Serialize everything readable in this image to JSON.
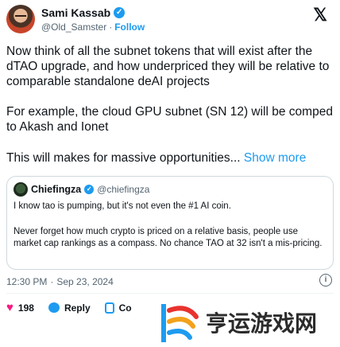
{
  "author": {
    "name": "Sami Kassab",
    "handle": "@Old_Samster",
    "separator": "·",
    "follow_label": "Follow"
  },
  "platform_icon": "x-logo-icon",
  "tweet": {
    "paragraph_1": "Now think of all the subnet tokens that will exist after the dTAO upgrade, and how underpriced they will be relative to comparable standalone deAI projects",
    "paragraph_2": "For example, the cloud GPU subnet (SN 12) will be comped to Akash and Ionet",
    "paragraph_3": "This will makes for massive opportunities...",
    "show_more": "Show more"
  },
  "quote": {
    "name": "Chiefingza",
    "handle": "@chiefingza",
    "line_1": "I know tao is pumping, but it's not even the #1 AI coin.",
    "line_2": "Never forget how much crypto is priced on a relative basis, people use market cap rankings as a compass. No chance TAO at 32 isn't a mis-pricing."
  },
  "meta": {
    "time": "12:30 PM",
    "separator": "·",
    "date": "Sep 23, 2024"
  },
  "actions": {
    "like_count": "198",
    "reply_label": "Reply",
    "copy_label": "Co"
  },
  "watermark": {
    "text": "亨运游戏网"
  },
  "colors": {
    "accent": "#1d9bf0",
    "like": "#f91880",
    "muted": "#536471",
    "border": "#cfd9de"
  }
}
